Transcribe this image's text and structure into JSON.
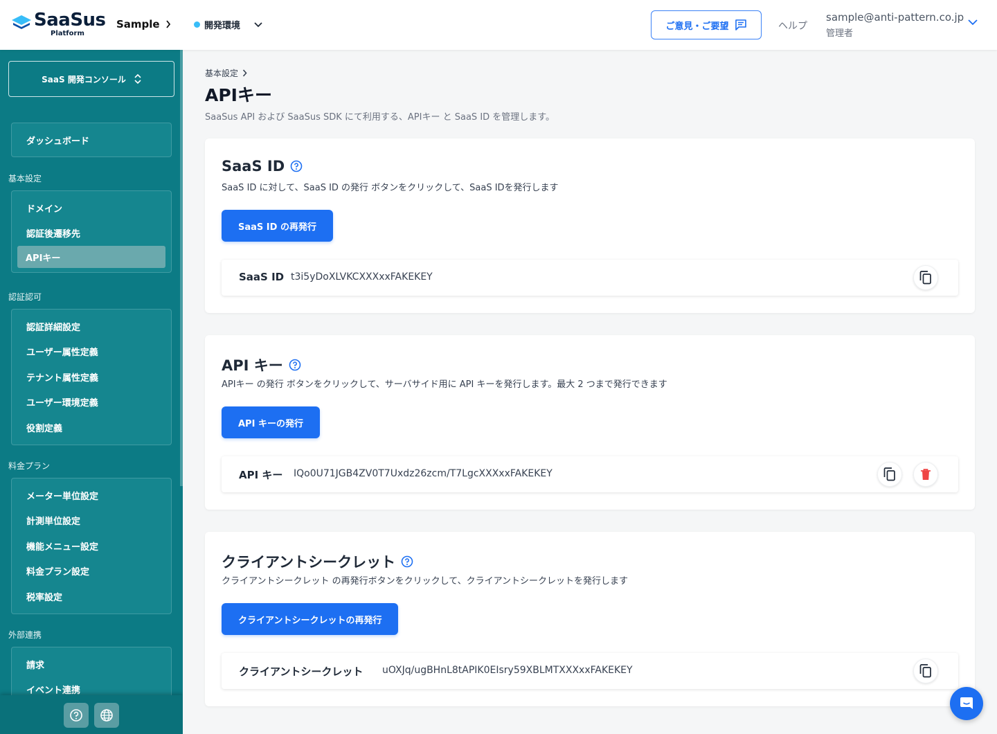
{
  "header": {
    "logo_name": "SaaSus",
    "logo_sub": "Platform",
    "app_name": "Sample",
    "environment": "開発環境",
    "feedback_label": "ご意見・ご要望",
    "help_label": "ヘルプ",
    "user_email": "sample@anti-pattern.co.jp",
    "user_role": "管理者"
  },
  "colors": {
    "sidebar": "#0c7b85",
    "primary": "#1d6ff2",
    "env_dot": "#38bdf8",
    "danger": "#ef4444"
  },
  "sidebar": {
    "console_label": "SaaS 開発コンソール",
    "dashboard": "ダッシュボード",
    "groups": [
      {
        "heading": "基本設定",
        "items": [
          "ドメイン",
          "認証後遷移先",
          "APIキー"
        ]
      },
      {
        "heading": "認証認可",
        "items": [
          "認証詳細設定",
          "ユーザー属性定義",
          "テナント属性定義",
          "ユーザー環境定義",
          "役割定義"
        ]
      },
      {
        "heading": "料金プラン",
        "items": [
          "メーター単位設定",
          "計測単位設定",
          "機能メニュー設定",
          "料金プラン設定",
          "税率設定"
        ]
      },
      {
        "heading": "外部連携",
        "items": [
          "請求",
          "イベント連携"
        ]
      }
    ],
    "active_item": "APIキー",
    "footer_icons": [
      "help-icon",
      "globe-icon"
    ]
  },
  "main": {
    "breadcrumb": "基本設定",
    "title": "APIキー",
    "description": "SaaSus API および SaaSus SDK にて利用する、APIキー と SaaS ID を管理します。",
    "cards": [
      {
        "title": "SaaS ID",
        "description": "SaaS ID に対して、SaaS ID の発行 ボタンをクリックして、SaaS IDを発行します",
        "button": "SaaS ID の再発行",
        "value_label": "SaaS ID",
        "value": "t3i5yDoXLVKCXXXxxFAKEKEY",
        "actions": [
          "copy-icon"
        ]
      },
      {
        "title": "API キー",
        "description": "APIキー の発行 ボタンをクリックして、サーバサイド用に API キーを発行します。最大 2 つまで発行できます",
        "button": "API キーの発行",
        "value_label": "API キー",
        "value": "IQo0U71JGB4ZV0T7Uxdz26zcm/T7LgcXXXxxFAKEKEY",
        "actions": [
          "copy-icon",
          "trash-icon"
        ]
      },
      {
        "title": "クライアントシークレット",
        "description": "クライアントシークレット の再発行ボタンをクリックして、クライアントシークレットを発行します",
        "button": "クライアントシークレットの再発行",
        "value_label": "クライアントシークレット",
        "value": "uOXJq/ugBHnL8tAPIK0EIsry59XBLMTXXXxxFAKEKEY",
        "actions": [
          "copy-icon"
        ]
      }
    ]
  }
}
